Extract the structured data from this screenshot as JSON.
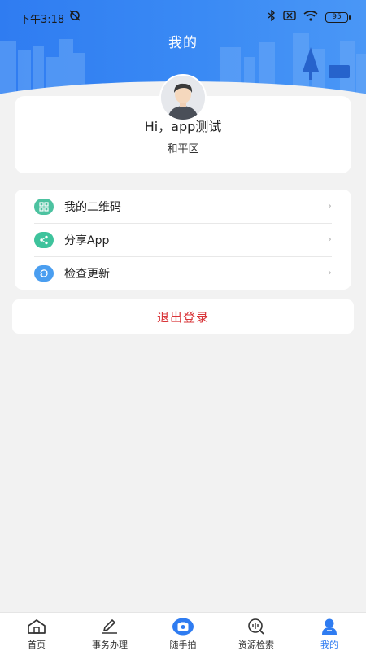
{
  "status_bar": {
    "time": "下午3:18",
    "battery": "95"
  },
  "header": {
    "title": "我的"
  },
  "profile": {
    "greeting": "Hi，app测试",
    "district": "和平区"
  },
  "menu": [
    {
      "label": "我的二维码",
      "icon": "qrcode-icon",
      "color": "#4cc2a0"
    },
    {
      "label": "分享App",
      "icon": "share-icon",
      "color": "#3ec39c"
    },
    {
      "label": "检查更新",
      "icon": "refresh-icon",
      "color": "#4a9ef0"
    }
  ],
  "logout": {
    "label": "退出登录",
    "color": "#d9363a"
  },
  "bottom_nav": [
    {
      "label": "首页",
      "icon": "home-icon"
    },
    {
      "label": "事务办理",
      "icon": "edit-icon"
    },
    {
      "label": "随手拍",
      "icon": "camera-icon"
    },
    {
      "label": "资源检索",
      "icon": "search-icon"
    },
    {
      "label": "我的",
      "icon": "user-icon",
      "active": true
    }
  ],
  "colors": {
    "accent": "#2f7cf1",
    "logout": "#d9363a"
  }
}
